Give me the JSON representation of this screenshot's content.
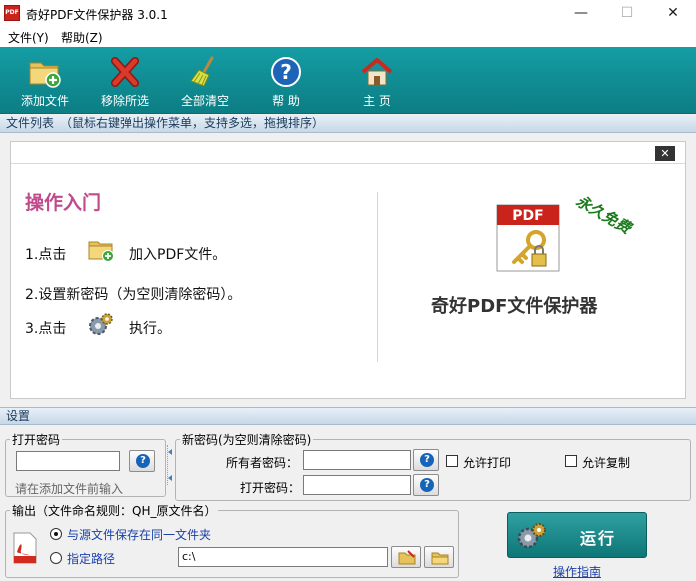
{
  "window": {
    "app_icon_text": "PDF",
    "title": "奇好PDF文件保护器 3.0.1",
    "minimize_glyph": "—",
    "maximize_glyph": "☐",
    "close_glyph": "✕"
  },
  "menu": {
    "items": [
      "文件(Y)",
      "帮助(Z)"
    ]
  },
  "toolbar": {
    "buttons": [
      {
        "label": "添加文件",
        "icon": "add-folder-icon"
      },
      {
        "label": "移除所选",
        "icon": "remove-x-icon"
      },
      {
        "label": "全部清空",
        "icon": "broom-icon"
      },
      {
        "label": "帮 助",
        "icon": "help-icon"
      },
      {
        "label": "主 页",
        "icon": "home-icon"
      }
    ]
  },
  "file_list": {
    "header": "文件列表　（鼠标右键弹出操作菜单，支持多选，拖拽排序）",
    "close_glyph": "✕"
  },
  "guide": {
    "heading": "操作入门",
    "step1_prefix": "1.点击",
    "step1_suffix": "加入PDF文件。",
    "step2": "2.设置新密码（为空则清除密码）。",
    "step3_prefix": "3.点击",
    "step3_suffix": "执行。",
    "stamp": "永久免费",
    "product_icon_text": "PDF",
    "product_name": "奇好PDF文件保护器"
  },
  "settings": {
    "header": "设置",
    "open_password": {
      "legend": "打开密码",
      "value": "",
      "hint": "请在添加文件前输入"
    },
    "new_password": {
      "legend": "新密码(为空则清除密码)",
      "owner_label": "所有者密码：",
      "owner_value": "",
      "open_label": "打开密码：",
      "open_value": "",
      "allow_print": "允许打印",
      "allow_copy": "允许复制"
    },
    "output": {
      "legend": "输出（文件命名规则：QH_原文件名）",
      "option_same": "与源文件保存在同一文件夹",
      "option_path": "指定路径",
      "path_value": "c:\\"
    },
    "run_label": "运行",
    "guide_link": "操作指南"
  },
  "colors": {
    "toolbar": "#0f8a90",
    "heading": "#c04a8c",
    "stamp": "#1b7a1b",
    "link": "#1a3fa8"
  }
}
